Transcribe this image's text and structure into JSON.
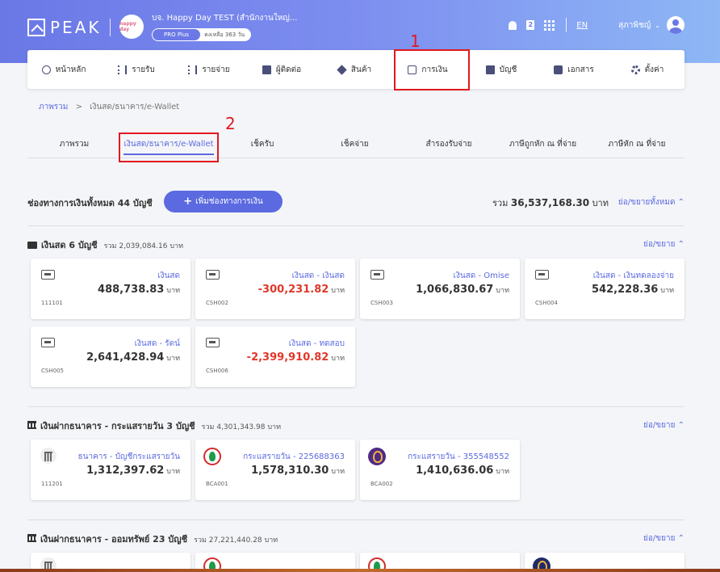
{
  "topbar": {
    "logo_text": "PEAK",
    "company_name": "บจ. Happy Day TEST (สำนักงานใหญ่...",
    "company_logo_text": "happy day",
    "plan_label": "PRO Plus",
    "plan_remaining": "คงเหลือ 363 วัน",
    "doc_badge": "2",
    "lang": "EN",
    "user_name": "สุภาพิชญ์",
    "caret": "⌄"
  },
  "mainnav": {
    "items": [
      {
        "label": "หน้าหลัก",
        "icon": "dashboard-icon"
      },
      {
        "label": "รายรับ",
        "icon": "income-icon"
      },
      {
        "label": "รายจ่าย",
        "icon": "expense-icon"
      },
      {
        "label": "ผู้ติดต่อ",
        "icon": "contact-icon"
      },
      {
        "label": "สินค้า",
        "icon": "box-icon"
      },
      {
        "label": "การเงิน",
        "icon": "money-icon"
      },
      {
        "label": "บัญชี",
        "icon": "book-icon"
      },
      {
        "label": "เอกสาร",
        "icon": "folder-icon"
      },
      {
        "label": "ตั้งค่า",
        "icon": "gear-icon"
      }
    ]
  },
  "annotations": {
    "step1": "1",
    "step2": "2",
    "highlight_color": "#e0191f"
  },
  "breadcrumb": {
    "root": "ภาพรวม",
    "separator": ">",
    "current": "เงินสด/ธนาคาร/e-Wallet"
  },
  "subtabs": [
    "ภาพรวม",
    "เงินสด/ธนาคาร/e-Wallet",
    "เช็ครับ",
    "เช็คจ่าย",
    "สำรองรับจ่าย",
    "ภาษีถูกหัก ณ ที่จ่าย",
    "ภาษีหัก ณ ที่จ่าย"
  ],
  "summary": {
    "title": "ช่องทางการเงินทั้งหมด 44 บัญชี",
    "add_button": "เพิ่มช่องทางการเงิน",
    "add_plus": "+",
    "total_label": "รวม",
    "total_amount": "36,537,168.30",
    "total_unit": "บาท",
    "expand_all": "ย่อ/ขยายทั้งหมด ⌃"
  },
  "sections": {
    "cash": {
      "title": "เงินสด 6 บัญชี",
      "total": "รวม 2,039,084.16 บาท",
      "toggle": "ย่อ/ขยาย ⌃",
      "cards": [
        {
          "name": "เงินสด",
          "amount": "488,738.83",
          "unit": "บาท",
          "code": "111101"
        },
        {
          "name": "เงินสด - เงินสด",
          "amount": "-300,231.82",
          "unit": "บาท",
          "code": "CSH002"
        },
        {
          "name": "เงินสด - Omise",
          "amount": "1,066,830.67",
          "unit": "บาท",
          "code": "CSH003"
        },
        {
          "name": "เงินสด - เงินทดลองจ่าย",
          "amount": "542,228.36",
          "unit": "บาท",
          "code": "CSH004"
        },
        {
          "name": "เงินสด - รัตน์",
          "amount": "2,641,428.94",
          "unit": "บาท",
          "code": "CSH005"
        },
        {
          "name": "เงินสด - ทดสอบ",
          "amount": "-2,399,910.82",
          "unit": "บาท",
          "code": "CSH006"
        }
      ]
    },
    "bank_current": {
      "title": "เงินฝากธนาคาร - กระแสรายวัน 3 บัญชี",
      "total": "รวม 4,301,343.98 บาท",
      "toggle": "ย่อ/ขยาย ⌃",
      "cards": [
        {
          "name": "ธนาคาร - บัญชีกระแสรายวัน",
          "amount": "1,312,397.62",
          "unit": "บาท",
          "code": "111201"
        },
        {
          "name": "กระแสรายวัน - 225688363",
          "amount": "1,578,310.30",
          "unit": "บาท",
          "code": "BCA001"
        },
        {
          "name": "กระแสรายวัน - 355548552",
          "amount": "1,410,636.06",
          "unit": "บาท",
          "code": "BCA002"
        }
      ]
    },
    "bank_savings": {
      "title": "เงินฝากธนาคาร - ออมทรัพย์ 23 บัญชี",
      "total": "รวม 27,221,440.28 บาท",
      "toggle": "ย่อ/ขยาย ⌃"
    }
  }
}
